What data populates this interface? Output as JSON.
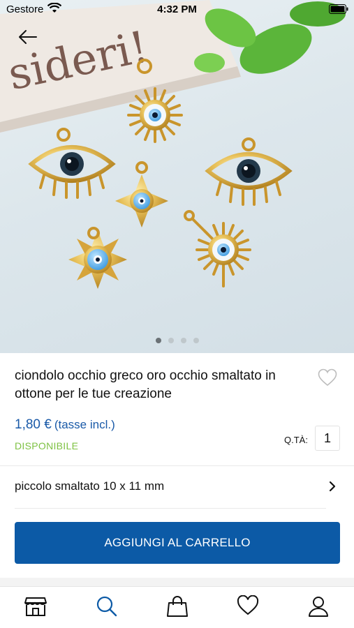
{
  "status_bar": {
    "carrier": "Gestore",
    "time": "4:32 PM"
  },
  "product": {
    "title": "ciondolo occhio greco oro occhio smaltato in ottone per le tue creazione",
    "price": "1,80 €",
    "tax_note": "(tasse incl.)",
    "availability": "DISPONIBILE",
    "quantity_label": "Q.TÀ:",
    "quantity": "1"
  },
  "gallery": {
    "image_count": 4,
    "active_index": 0,
    "background_text": "sideri!"
  },
  "variant": {
    "label": "piccolo smaltato 10 x 11 mm"
  },
  "cart_button": {
    "label": "AGGIUNGI AL CARRELLO"
  },
  "tabbar": {
    "items": [
      {
        "icon": "store-icon",
        "active": false
      },
      {
        "icon": "search-icon",
        "active": true
      },
      {
        "icon": "shopping-bag-icon",
        "active": false
      },
      {
        "icon": "heart-icon",
        "active": false
      },
      {
        "icon": "user-icon",
        "active": false
      }
    ]
  },
  "colors": {
    "accent": "#0c5aa6",
    "price": "#1a5aa8",
    "availability": "#7ec143",
    "gold": "#d9a93a"
  }
}
